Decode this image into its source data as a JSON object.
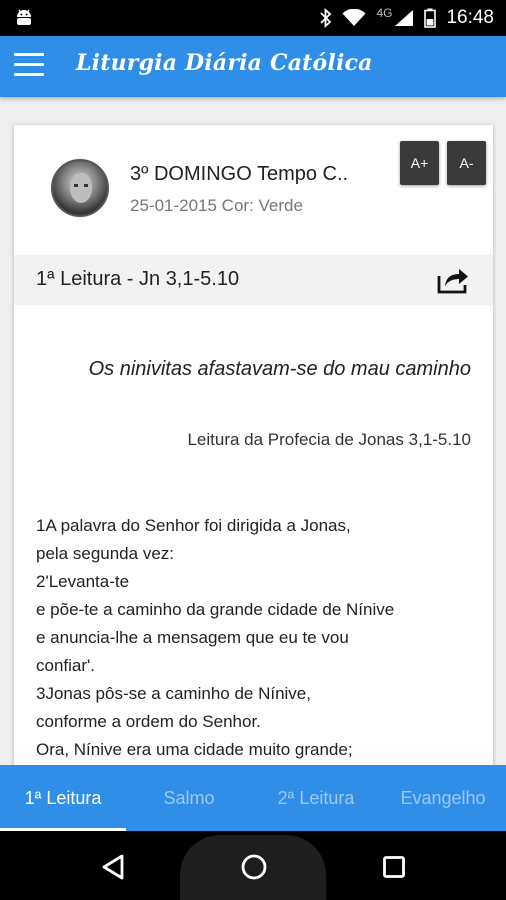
{
  "status_bar": {
    "network": "4G",
    "time": "16:48"
  },
  "app_bar": {
    "title": "Liturgia Diária Católica"
  },
  "header": {
    "day_title": "3º DOMINGO Tempo C..",
    "date_color": "25-01-2015 Cor: Verde",
    "font_increase_label": "A+",
    "font_decrease_label": "A-"
  },
  "reading": {
    "label": "1ª Leitura - Jn 3,1-5.10",
    "title": "Os ninivitas afastavam-se do mau caminho",
    "source": "Leitura da Profecia de Jonas 3,1-5.10",
    "lines": [
      " 1A palavra do Senhor foi dirigida a Jonas,",
      " pela segunda vez:",
      " 2'Levanta-te",
      " e põe-te a caminho da grande cidade de Nínive",
      " e anuncia-lhe a mensagem que eu te vou",
      "confiar'.",
      " 3Jonas pôs-se a caminho de Nínive,",
      " conforme a ordem do Senhor.",
      " Ora, Nínive era uma cidade muito grande;"
    ]
  },
  "tabs": [
    "1ª Leitura",
    "Salmo",
    "2ª Leitura",
    "Evangelho"
  ],
  "active_tab": "1ª Leitura",
  "colors": {
    "primary": "#2f8fe8",
    "inactive_tab_text": "#9cc9f3"
  }
}
